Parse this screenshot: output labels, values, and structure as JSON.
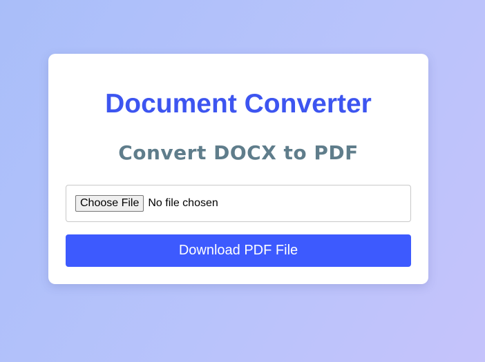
{
  "app": {
    "title": "Document Converter",
    "subtitle": "Convert DOCX to PDF"
  },
  "file_input": {
    "button_label": "Choose File",
    "status_text": "No file chosen"
  },
  "actions": {
    "download_label": "Download PDF File"
  },
  "colors": {
    "title": "#3d55f0",
    "subtitle": "#5f7d8b",
    "primary_button": "#3d5afe",
    "card_background": "#ffffff",
    "page_gradient_start": "#a9bef9",
    "page_gradient_end": "#c5c3fb"
  }
}
